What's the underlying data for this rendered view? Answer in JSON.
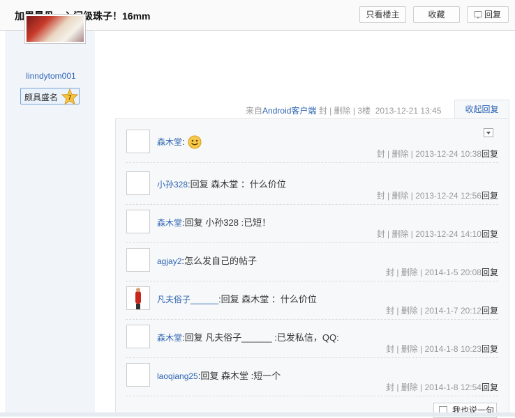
{
  "header": {
    "title": "加里曼丹，入门级珠子！16mm",
    "buttons": {
      "only_op": "只看楼主",
      "favorite": "收藏",
      "reply": "回复"
    }
  },
  "author": {
    "name": "linndytom001",
    "badge_text": "颇具盛名",
    "badge_level": "7"
  },
  "post_meta": {
    "from_prefix": "来自",
    "client": "Android客户端",
    "seal": "封",
    "delete": "删除",
    "floor": "3楼",
    "time": "2013-12-21 13:45",
    "collapse_label": "收起回复"
  },
  "comments": [
    {
      "user": "森木堂",
      "text": "",
      "has_smiley": true,
      "footer": "封 | 删除 | 2013-12-24 10:38",
      "reply": "回复",
      "avatar": "sky"
    },
    {
      "user": "小孙328",
      "text": "回复 森木堂 ：什么价位",
      "footer": "封 | 删除 | 2013-12-24 12:56",
      "reply": "回复",
      "avatar": "beads"
    },
    {
      "user": "森木堂",
      "text": "回复 小孙328 :已短！",
      "footer": "封 | 删除 | 2013-12-24 14:10",
      "reply": "回复",
      "avatar": "sky"
    },
    {
      "user": "agjay2",
      "text": "怎么发自己的帖子",
      "footer": "封 | 删除 | 2014-1-5 20:08",
      "reply": "回复",
      "avatar": "face"
    },
    {
      "user": "凡夫俗子______",
      "text": "回复 森木堂 ：什么价位",
      "footer": "封 | 删除 | 2014-1-7 20:12",
      "reply": "回复",
      "avatar": "man"
    },
    {
      "user": "森木堂",
      "text": "回复 凡夫俗子______ :已发私信，QQ:",
      "footer": "封 | 删除 | 2014-1-8 10:23",
      "reply": "回复",
      "avatar": "sky"
    },
    {
      "user": "laoqiang25",
      "text": "回复 森木堂 :短一个",
      "footer": "封 | 删除 | 2014-1-8 12:54",
      "reply": "回复",
      "avatar": "dark"
    }
  ],
  "add_comment_label": "我也说一句"
}
